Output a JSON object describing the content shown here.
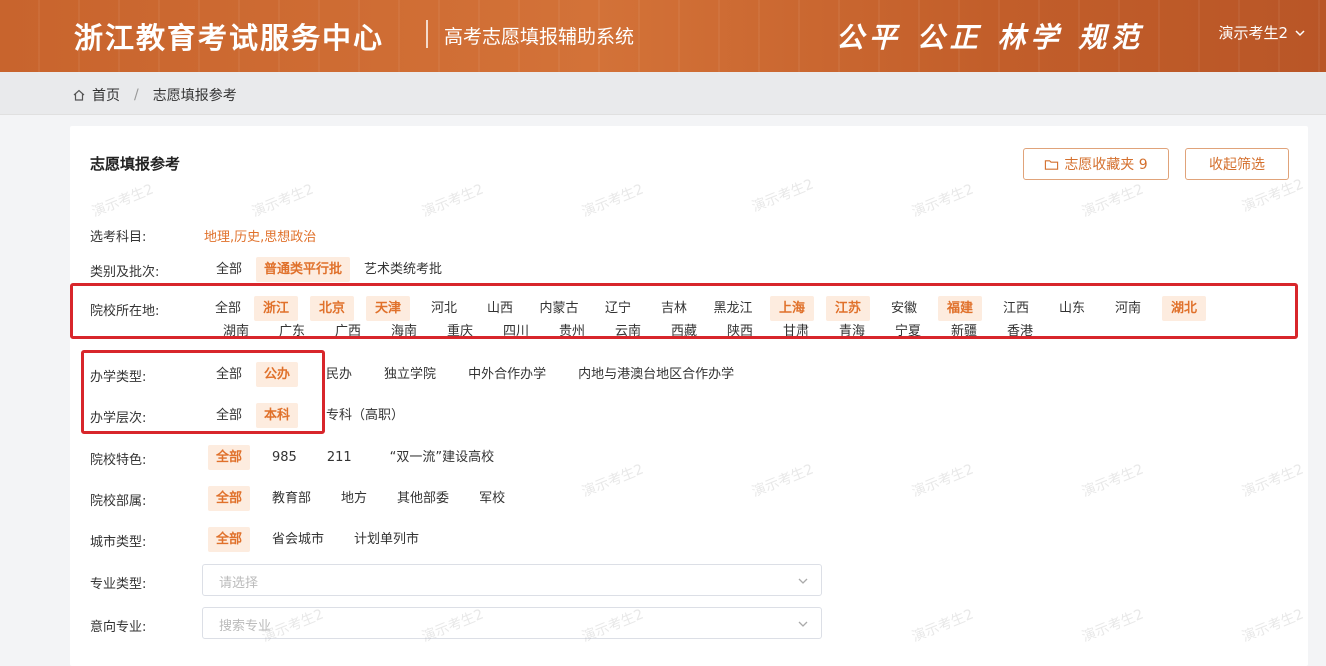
{
  "header": {
    "brand": "浙江教育考试服务中心",
    "subtitle": "高考志愿填报辅助系统",
    "motto": "公平 公正 林学 规范",
    "user": "演示考生2"
  },
  "breadcrumb": {
    "home": "首页",
    "current": "志愿填报参考"
  },
  "card": {
    "title": "志愿填报参考",
    "fav_button": "志愿收藏夹 9",
    "fold_button": "收起筛选"
  },
  "filters": {
    "subjects": {
      "label": "选考科目:",
      "value": "地理,历史,思想政治"
    },
    "batch": {
      "label": "类别及批次:",
      "options": [
        "全部",
        "普通类平行批",
        "艺术类统考批"
      ],
      "selected": [
        1
      ]
    },
    "location": {
      "label": "院校所在地:",
      "row1": [
        "全部",
        "浙江",
        "北京",
        "天津",
        "河北",
        "山西",
        "内蒙古",
        "辽宁",
        "吉林",
        "黑龙江",
        "上海",
        "江苏",
        "安徽",
        "福建",
        "江西",
        "山东",
        "河南",
        "湖北"
      ],
      "row1_selected": [
        1,
        2,
        3,
        10,
        11,
        13,
        17
      ],
      "row2": [
        "湖南",
        "广东",
        "广西",
        "海南",
        "重庆",
        "四川",
        "贵州",
        "云南",
        "西藏",
        "陕西",
        "甘肃",
        "青海",
        "宁夏",
        "新疆",
        "香港"
      ]
    },
    "school_type": {
      "label": "办学类型:",
      "options": [
        "全部",
        "公办",
        "民办",
        "独立学院",
        "中外合作办学",
        "内地与港澳台地区合作办学"
      ],
      "selected": [
        1
      ]
    },
    "school_level": {
      "label": "办学层次:",
      "options": [
        "全部",
        "本科",
        "专科（高职）"
      ],
      "selected": [
        1
      ]
    },
    "features": {
      "label": "院校特色:",
      "options": [
        "全部",
        "985",
        "211",
        "“双一流”建设高校"
      ],
      "selected": [
        0
      ]
    },
    "affiliation": {
      "label": "院校部属:",
      "options": [
        "全部",
        "教育部",
        "地方",
        "其他部委",
        "军校"
      ],
      "selected": [
        0
      ]
    },
    "city_type": {
      "label": "城市类型:",
      "options": [
        "全部",
        "省会城市",
        "计划单列市"
      ],
      "selected": [
        0
      ]
    },
    "major_type": {
      "label": "专业类型:",
      "placeholder": "请选择"
    },
    "intended_major": {
      "label": "意向专业:",
      "placeholder": "搜索专业"
    }
  },
  "watermark": "演示考生2",
  "colors": {
    "accent": "#e0712b",
    "header": "#c8642d",
    "annotation": "#d8262b"
  }
}
